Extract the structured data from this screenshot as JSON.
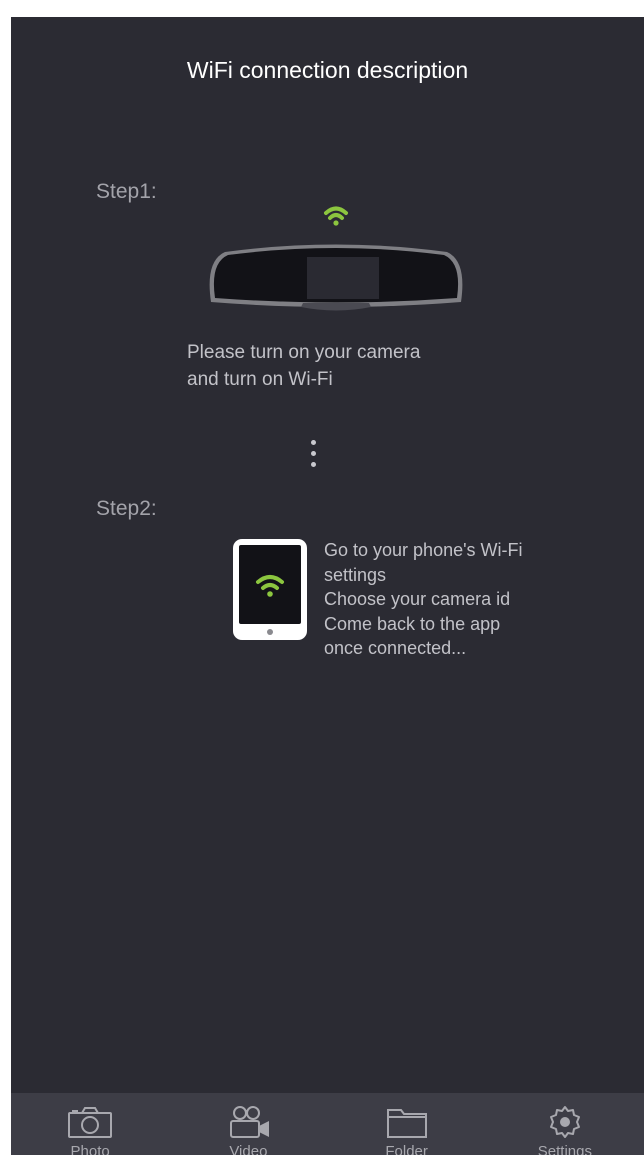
{
  "header": {
    "title": "WiFi connection description"
  },
  "step1": {
    "label": "Step1:",
    "instructions": [
      "Please turn on your camera",
      "and turn on Wi-Fi"
    ],
    "icons": [
      "wifi-icon",
      "dashcam-mirror-icon"
    ]
  },
  "step2": {
    "label": "Step2:",
    "instructions": [
      "Go to your phone's Wi-Fi",
      "settings",
      "Choose your camera id",
      "Come back to the app",
      "once connected..."
    ],
    "icons": [
      "phone-icon",
      "wifi-icon"
    ]
  },
  "tabbar": {
    "tabs": [
      {
        "label": "Photo",
        "icon": "camera-icon"
      },
      {
        "label": "Video",
        "icon": "video-camera-icon"
      },
      {
        "label": "Folder",
        "icon": "folder-icon"
      },
      {
        "label": "Settings",
        "icon": "gear-icon"
      }
    ]
  },
  "colors": {
    "background": "#2b2b33",
    "tabbar": "#3d3d46",
    "wifi_accent": "#8cc63f",
    "title": "#ffffff",
    "text": "#c2c2c8"
  }
}
